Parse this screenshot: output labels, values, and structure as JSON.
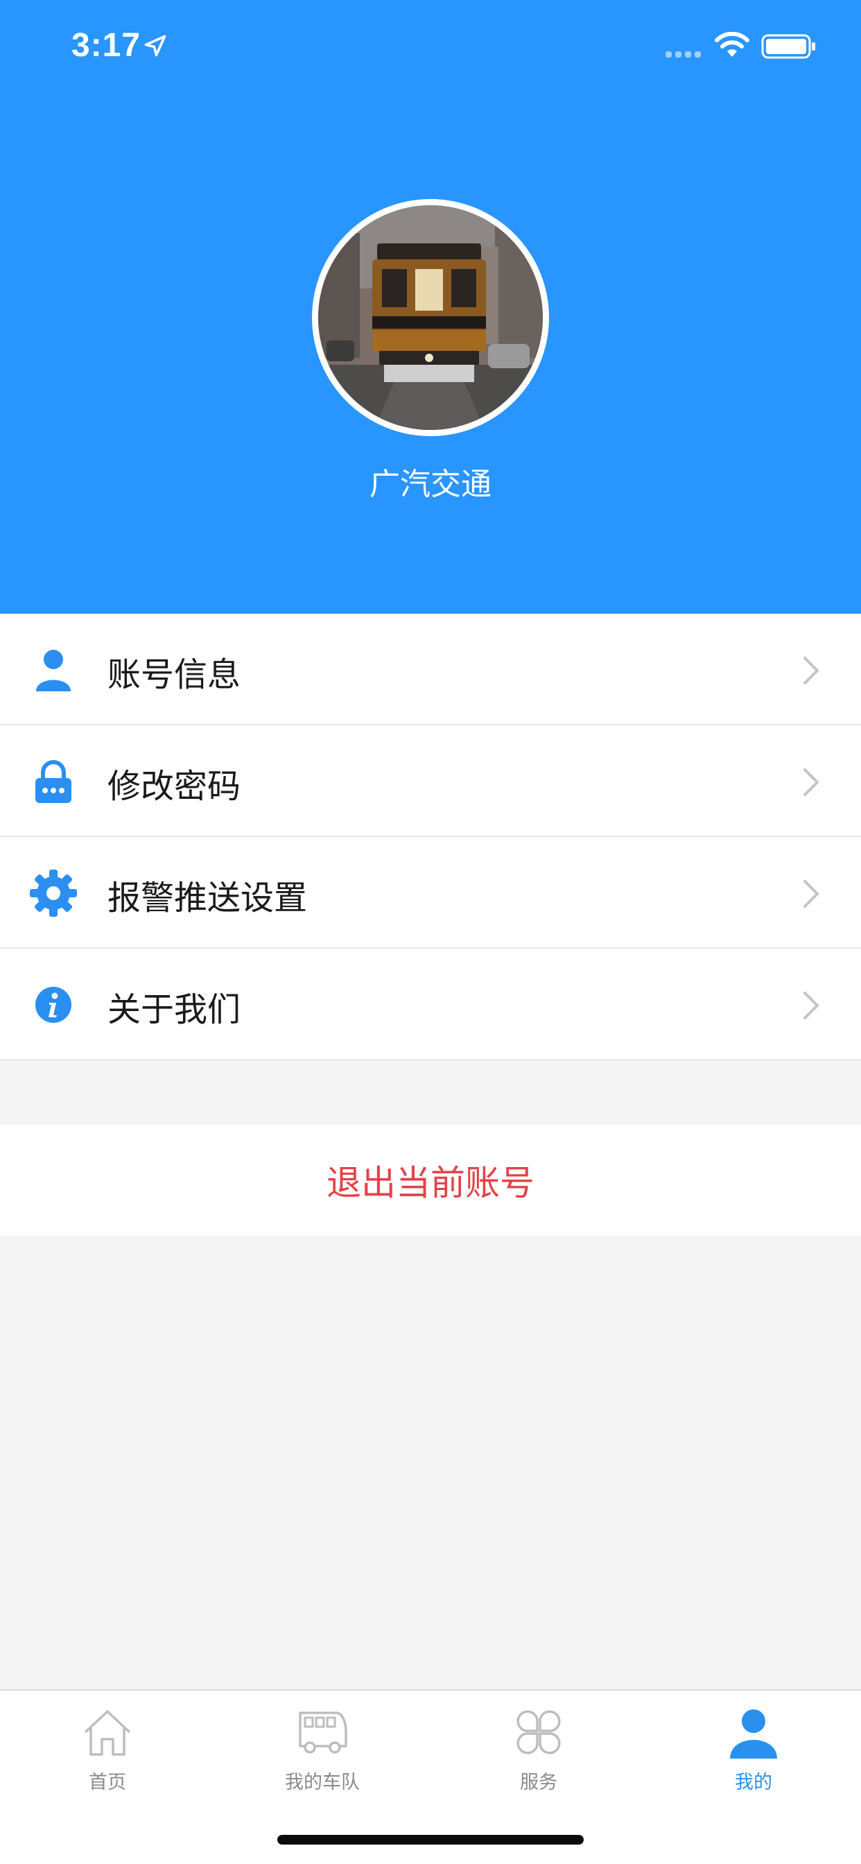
{
  "status_bar": {
    "time": "3:17"
  },
  "profile": {
    "name": "广汽交通"
  },
  "menu": {
    "items": [
      {
        "label": "账号信息",
        "icon": "person-icon"
      },
      {
        "label": "修改密码",
        "icon": "lock-icon"
      },
      {
        "label": "报警推送设置",
        "icon": "gear-icon"
      },
      {
        "label": "关于我们",
        "icon": "info-icon"
      }
    ]
  },
  "logout": {
    "label": "退出当前账号"
  },
  "tabbar": {
    "tabs": [
      {
        "label": "首页",
        "icon": "home-icon",
        "active": false
      },
      {
        "label": "我的车队",
        "icon": "bus-icon",
        "active": false
      },
      {
        "label": "服务",
        "icon": "clover-grid-icon",
        "active": false
      },
      {
        "label": "我的",
        "icon": "person-icon",
        "active": true
      }
    ]
  },
  "colors": {
    "header_blue": "#2995ff",
    "icon_blue": "#2a8ff0",
    "logout_red": "#e4424a",
    "tab_active": "#2990ef",
    "tab_inactive": "#8a8a8a"
  }
}
